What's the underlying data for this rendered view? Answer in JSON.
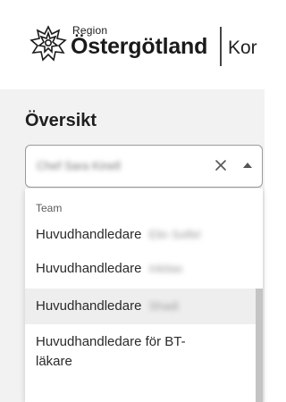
{
  "header": {
    "logo_small": "Region",
    "logo_big": "Östergötland",
    "app_label": "Kor"
  },
  "overview": {
    "title": "Översikt",
    "select_value": "Chef Sara Kinell"
  },
  "dropdown": {
    "group_label": "Team",
    "options": [
      {
        "label": "Huvudhandledare",
        "detail": "Elin Solfel"
      },
      {
        "label": "Huvudhandledare",
        "detail": "Inkitas"
      },
      {
        "label": "Huvudhandledare",
        "detail": "Shadi"
      },
      {
        "label": "Huvudhandledare för BT-",
        "label2": "läkare"
      }
    ]
  },
  "icons": {
    "logo": "region-ostergotland-logo-icon",
    "clear": "close-icon",
    "caret": "caret-up-icon"
  }
}
